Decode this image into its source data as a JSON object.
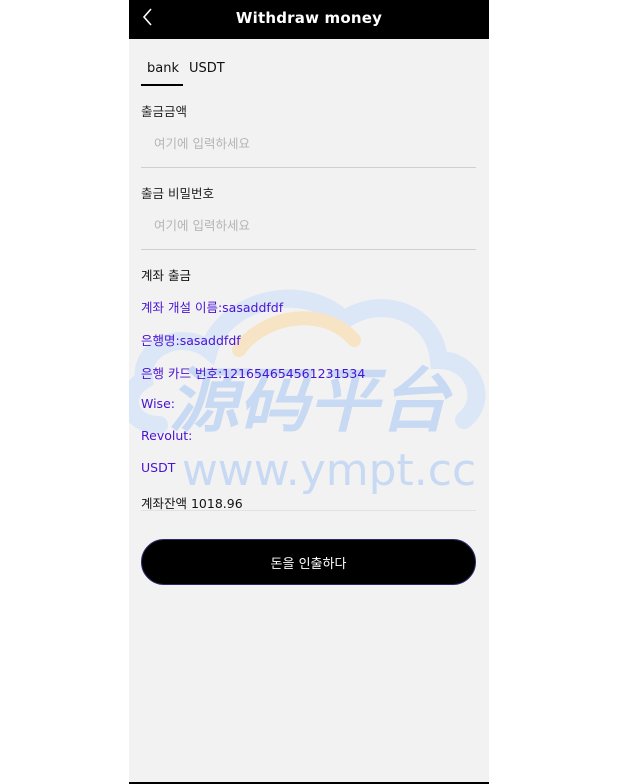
{
  "header": {
    "title": "Withdraw money",
    "back_icon": "chevron-left-icon"
  },
  "tabs": [
    {
      "label": "bank",
      "active": true
    },
    {
      "label": "USDT",
      "active": false
    }
  ],
  "amount_field": {
    "label": "출금금액",
    "placeholder": "여기에 입력하세요",
    "value": ""
  },
  "password_field": {
    "label": "출금 비밀번호",
    "placeholder": "여기에 입력하세요",
    "value": ""
  },
  "account": {
    "section_title": "계좌 출금",
    "account_name": "계좌 개설 이름:sasaddfdf",
    "bank_name": "은행명:sasaddfdf",
    "card_number": "은행 카드 번호:121654654561231534",
    "wise": "Wise:",
    "revolut": "Revolut:",
    "usdt": "USDT",
    "balance": "계좌잔액 1018.96"
  },
  "watermark": {
    "title": "源码平台",
    "url": "www.ympt.cc"
  },
  "withdraw_button": {
    "label": "돈을 인출하다"
  },
  "colors": {
    "accent_text": "#4a12d4",
    "header_bg": "#000000",
    "page_bg": "#f2f2f2"
  }
}
